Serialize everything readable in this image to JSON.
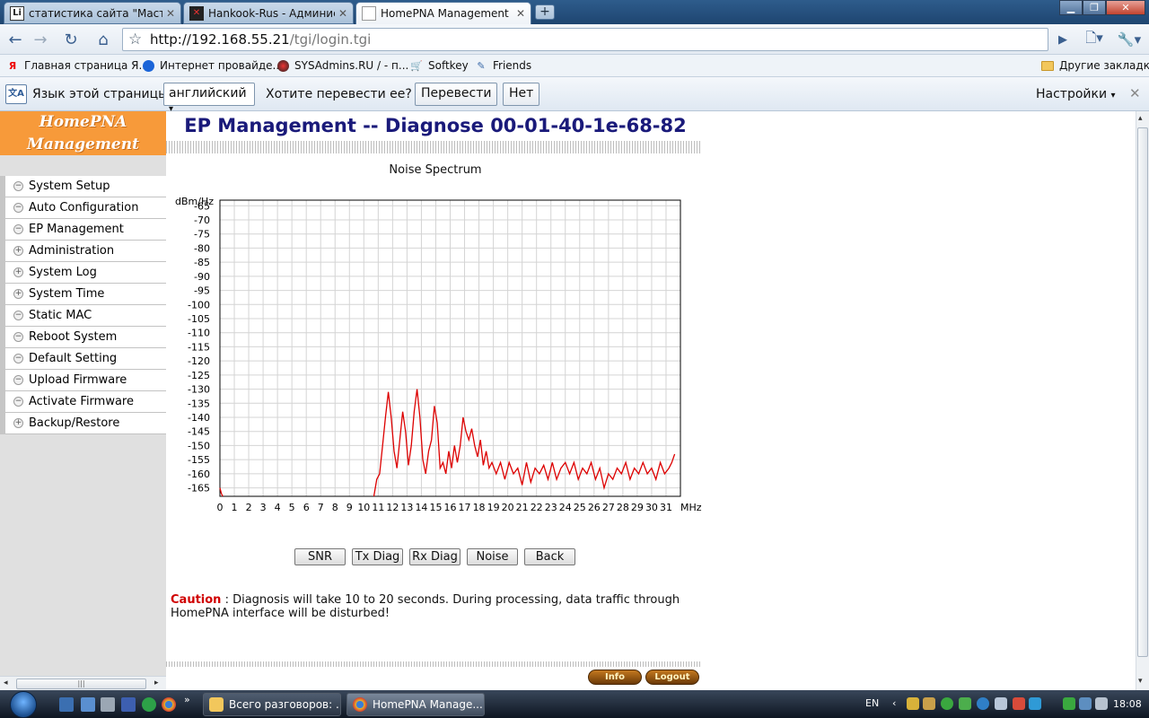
{
  "browser": {
    "tabs": [
      {
        "label": "статистика сайта \"Масте...",
        "active": false
      },
      {
        "label": "Hankook-Rus - Админис...",
        "active": false
      },
      {
        "label": "HomePNA Management",
        "active": true
      }
    ],
    "url_host": "http://192.168.55.21",
    "url_path": "/tgi/login.tgi"
  },
  "bookmarks": [
    {
      "label": "Главная страница Я...",
      "icon": "yandex-icon"
    },
    {
      "label": "Интернет провайде...",
      "icon": "globe-icon"
    },
    {
      "label": "SYSAdmins.RU / - п...",
      "icon": "sysadmins-icon"
    },
    {
      "label": "Softkey",
      "icon": "softkey-icon"
    },
    {
      "label": "Friends",
      "icon": "friends-icon"
    },
    {
      "label": "Другие закладки",
      "icon": "folder-icon"
    }
  ],
  "translate": {
    "prompt": "Язык этой страницы",
    "language": "английский",
    "question": "Хотите перевести ее?",
    "translate_label": "Перевести",
    "no_label": "Нет",
    "settings_label": "Настройки"
  },
  "sidebar": {
    "brand_line1": "HomePNA",
    "brand_line2": "Management",
    "items": [
      {
        "label": "System Setup",
        "icon": "minus"
      },
      {
        "label": "Auto Configuration",
        "icon": "minus"
      },
      {
        "label": "EP Management",
        "icon": "minus"
      },
      {
        "label": "Administration",
        "icon": "plus"
      },
      {
        "label": "System Log",
        "icon": "plus"
      },
      {
        "label": "System Time",
        "icon": "plus"
      },
      {
        "label": "Static MAC",
        "icon": "minus"
      },
      {
        "label": "Reboot System",
        "icon": "minus"
      },
      {
        "label": "Default Setting",
        "icon": "minus"
      },
      {
        "label": "Upload Firmware",
        "icon": "minus"
      },
      {
        "label": "Activate Firmware",
        "icon": "minus"
      },
      {
        "label": "Backup/Restore",
        "icon": "plus"
      }
    ]
  },
  "main": {
    "title": "EP Management -- Diagnose 00-01-40-1e-68-82",
    "buttons": {
      "snr": "SNR",
      "tx": "Tx Diag",
      "rx": "Rx Diag",
      "noise": "Noise",
      "back": "Back"
    },
    "caution_label": "Caution",
    "caution_text": " : Diagnosis will take 10 to 20 seconds. During processing, data traffic through HomePNA interface will be disturbed!",
    "info_label": "Info",
    "logout_label": "Logout"
  },
  "chart_data": {
    "type": "line",
    "title": "Noise Spectrum",
    "ylabel": "dBm/Hz",
    "xlabel": "MHz",
    "xlim": [
      0,
      32
    ],
    "ylim": [
      -168,
      -63
    ],
    "x_ticks": [
      0,
      1,
      2,
      3,
      4,
      5,
      6,
      7,
      8,
      9,
      10,
      11,
      12,
      13,
      14,
      15,
      16,
      17,
      18,
      19,
      20,
      21,
      22,
      23,
      24,
      25,
      26,
      27,
      28,
      29,
      30,
      31
    ],
    "y_ticks": [
      -65,
      -70,
      -75,
      -80,
      -85,
      -90,
      -95,
      -100,
      -105,
      -110,
      -115,
      -120,
      -125,
      -130,
      -135,
      -140,
      -145,
      -150,
      -155,
      -160,
      -165
    ],
    "grid": true,
    "color": "#dd0000",
    "series": [
      {
        "x": [
          0,
          0.1,
          0.2,
          10.7,
          10.9,
          11.1,
          11.3,
          11.5,
          11.7,
          11.9,
          12.1,
          12.3,
          12.5,
          12.7,
          12.9,
          13.1,
          13.3,
          13.5,
          13.7,
          13.9,
          14.1,
          14.3,
          14.5,
          14.7,
          14.9,
          15.1,
          15.3,
          15.5,
          15.7,
          15.9,
          16.1,
          16.3,
          16.5,
          16.7,
          16.9,
          17.1,
          17.3,
          17.5,
          17.7,
          17.9,
          18.1,
          18.3,
          18.5,
          18.7,
          18.9,
          19.2,
          19.5,
          19.8,
          20.1,
          20.4,
          20.7,
          21.0,
          21.3,
          21.6,
          21.9,
          22.2,
          22.5,
          22.8,
          23.1,
          23.4,
          23.7,
          24.0,
          24.3,
          24.6,
          24.9,
          25.2,
          25.5,
          25.8,
          26.1,
          26.4,
          26.7,
          27.0,
          27.3,
          27.6,
          27.9,
          28.2,
          28.5,
          28.8,
          29.1,
          29.4,
          29.7,
          30.0,
          30.3,
          30.6,
          30.9,
          31.2,
          31.4,
          31.6
        ],
        "y": [
          -165,
          -167,
          -168,
          -168,
          -162,
          -160,
          -150,
          -140,
          -131,
          -140,
          -152,
          -158,
          -148,
          -138,
          -145,
          -157,
          -150,
          -138,
          -130,
          -140,
          -155,
          -160,
          -152,
          -148,
          -136,
          -142,
          -158,
          -156,
          -160,
          -152,
          -158,
          -150,
          -156,
          -150,
          -140,
          -145,
          -148,
          -144,
          -150,
          -154,
          -148,
          -157,
          -152,
          -158,
          -156,
          -160,
          -156,
          -162,
          -156,
          -160,
          -158,
          -164,
          -156,
          -163,
          -158,
          -160,
          -157,
          -162,
          -156,
          -162,
          -158,
          -156,
          -160,
          -156,
          -162,
          -158,
          -160,
          -156,
          -162,
          -158,
          -165,
          -160,
          -162,
          -158,
          -160,
          -156,
          -162,
          -158,
          -160,
          -156,
          -160,
          -158,
          -162,
          -156,
          -160,
          -158,
          -156,
          -153
        ]
      }
    ]
  }
}
